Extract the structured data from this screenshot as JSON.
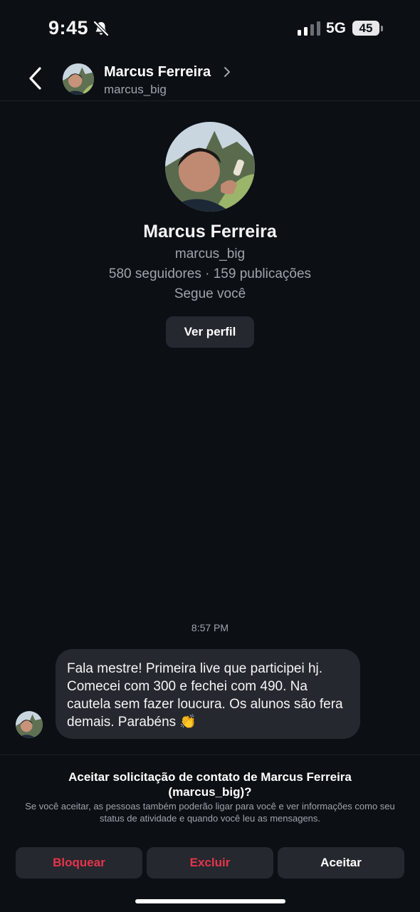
{
  "status_bar": {
    "time": "9:45",
    "network": "5G",
    "battery": "45"
  },
  "header": {
    "name": "Marcus Ferreira",
    "username": "marcus_big"
  },
  "profile": {
    "name": "Marcus Ferreira",
    "username": "marcus_big",
    "stats": "580 seguidores · 159 publicações",
    "follows_you": "Segue você",
    "view_profile_label": "Ver perfil"
  },
  "chat": {
    "timestamp": "8:57 PM",
    "message": "Fala mestre! Primeira live que participei hj. Comecei com 300 e fechei com 490. Na cautela sem fazer loucura. Os alunos são fera demais. Parabéns 👏"
  },
  "request": {
    "title": "Aceitar solicitação de contato de Marcus Ferreira (marcus_big)?",
    "description": "Se você aceitar, as pessoas também poderão ligar para você e ver informações como seu status de atividade e quando você leu as mensagens."
  },
  "actions": {
    "block": "Bloquear",
    "delete": "Excluir",
    "accept": "Aceitar"
  },
  "colors": {
    "danger": "#e5344c",
    "background": "#0c0f14",
    "surface": "#25282e",
    "muted": "#a0a4ab"
  },
  "icons": [
    "muted-bell-icon",
    "signal-icon",
    "battery-icon",
    "back-chevron-icon",
    "chevron-right-icon"
  ]
}
